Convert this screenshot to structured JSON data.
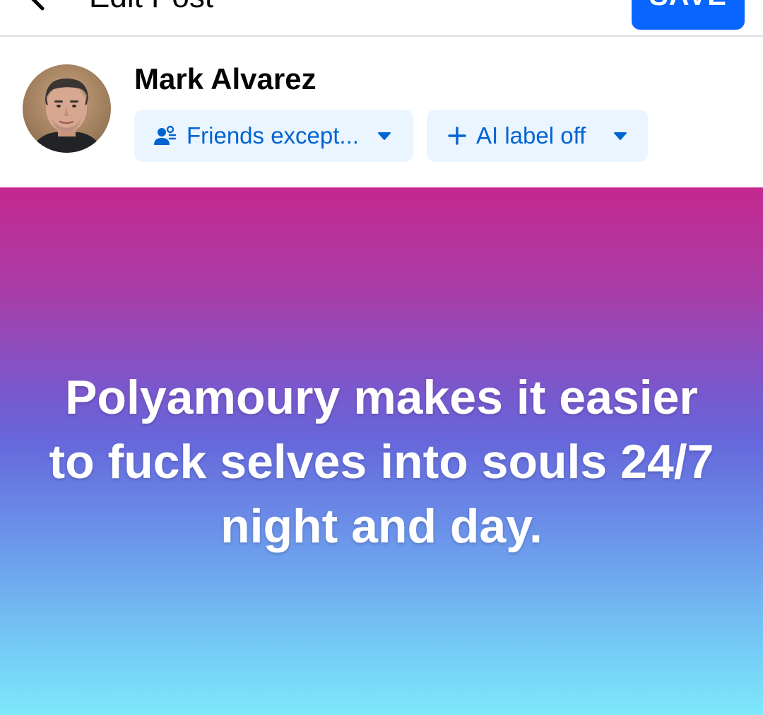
{
  "topbar": {
    "back_icon": "chevron-left-icon",
    "title": "Edit Post",
    "save_label": "SAVE",
    "save_color": "#0866ff"
  },
  "author": {
    "name": "Mark Alvarez",
    "avatar_icon": "profile-photo"
  },
  "audience_chip": {
    "icon": "friends-icon",
    "label": "Friends except...",
    "caret_icon": "caret-down-icon"
  },
  "ai_chip": {
    "icon": "plus-icon",
    "label": "AI label off",
    "caret_icon": "caret-down-icon"
  },
  "post": {
    "text": "Polyamoury makes it easier to fuck selves into souls 24/7 night and day.",
    "gradient_top": "#c4288f",
    "gradient_bottom": "#7de8fb"
  },
  "colors": {
    "chip_bg": "#ebf5ff",
    "chip_text": "#0064d1",
    "divider": "#dadde1"
  }
}
